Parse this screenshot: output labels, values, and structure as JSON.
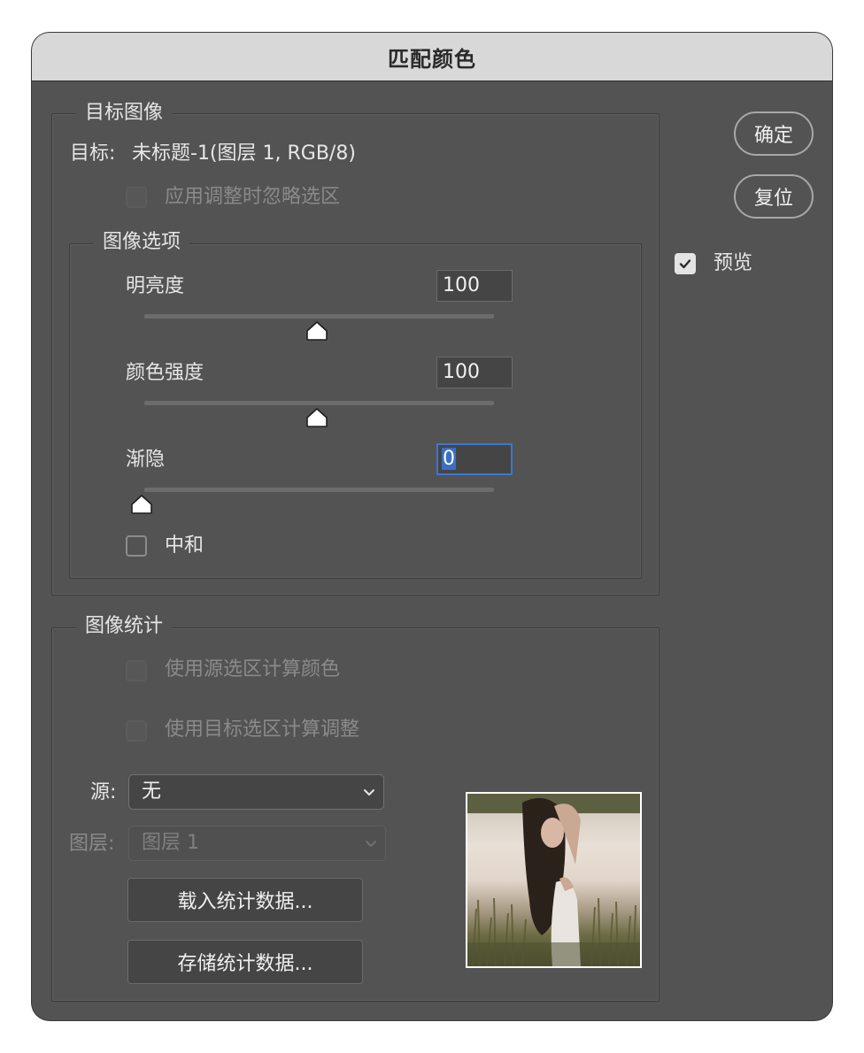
{
  "window": {
    "title": "匹配颜色"
  },
  "buttons": {
    "ok": "确定",
    "reset": "复位"
  },
  "preview": {
    "label": "预览",
    "checked": true
  },
  "target_image": {
    "legend": "目标图像",
    "target_label": "目标:",
    "target_value": "未标题-1(图层 1, RGB/8)",
    "ignore_selection_label": "应用调整时忽略选区"
  },
  "image_options": {
    "legend": "图像选项",
    "luminance": {
      "label": "明亮度",
      "value": "100",
      "level_fraction": 0.5
    },
    "color_intensity": {
      "label": "颜色强度",
      "value": "100",
      "level_fraction": 0.5
    },
    "fade": {
      "label": "渐隐",
      "value": "0",
      "level_fraction": 0.0
    },
    "neutralize": {
      "label": "中和",
      "checked": false
    }
  },
  "image_statistics": {
    "legend": "图像统计",
    "use_source_selection": "使用源选区计算颜色",
    "use_target_selection": "使用目标选区计算调整",
    "source_label": "源:",
    "source_value": "无",
    "layer_label": "图层:",
    "layer_value": "图层 1",
    "load_stats": "载入统计数据...",
    "save_stats": "存储统计数据..."
  },
  "icons": {
    "checkmark": "checkmark-icon",
    "chevron": "chevron-down-icon",
    "slider_thumb": "slider-thumb-icon"
  },
  "colors": {
    "panel": "#535353",
    "titlebar": "#d8d8d8",
    "focus": "#3b77d3"
  }
}
